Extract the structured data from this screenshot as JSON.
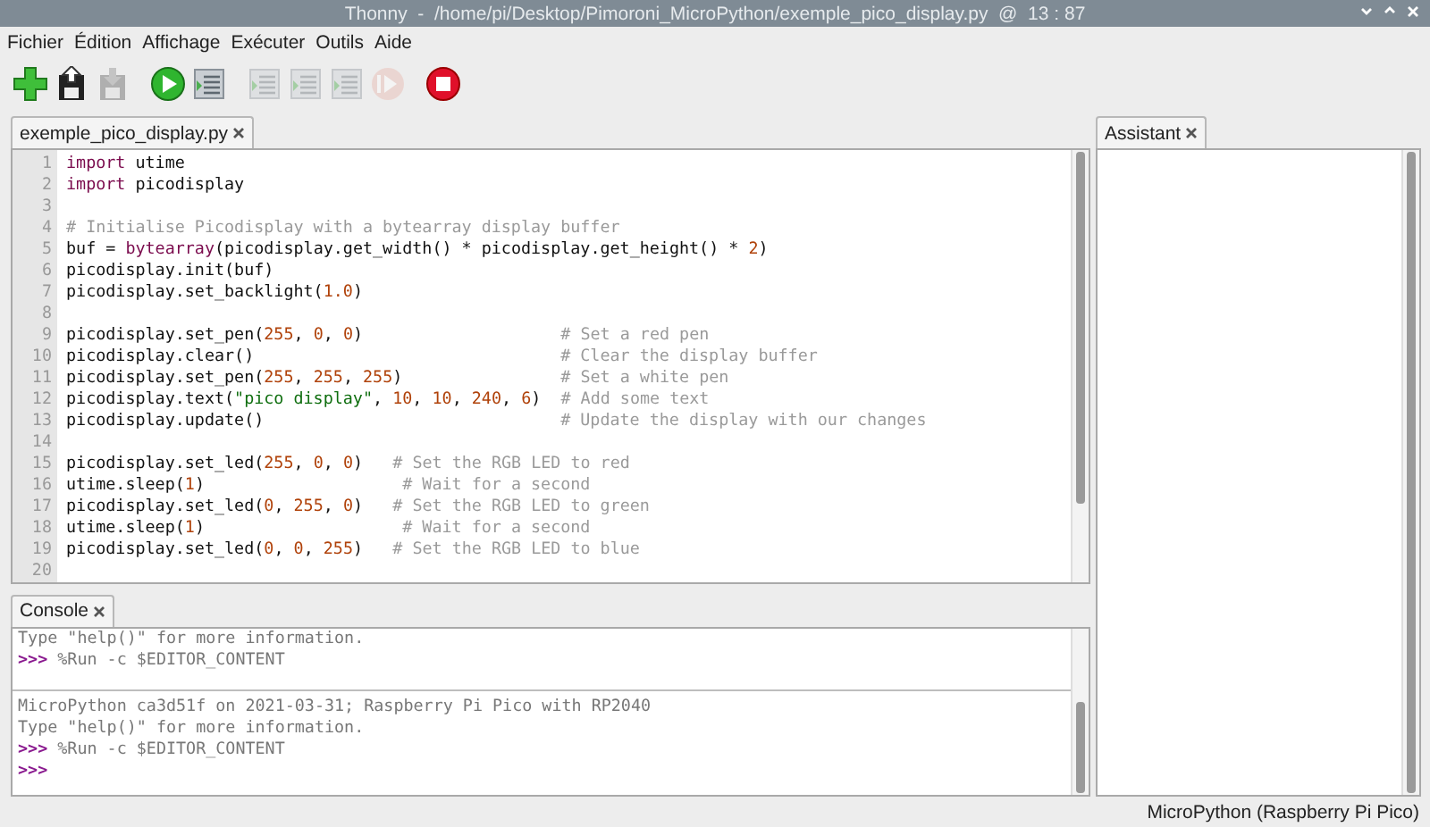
{
  "window": {
    "title": "Thonny  -  /home/pi/Desktop/Pimoroni_MicroPython/exemple_pico_display.py  @  13 : 87"
  },
  "menu": [
    "Fichier",
    "Édition",
    "Affichage",
    "Exécuter",
    "Outils",
    "Aide"
  ],
  "toolbar": [
    {
      "kind": "new",
      "disabled": false
    },
    {
      "kind": "load",
      "disabled": false
    },
    {
      "kind": "save",
      "disabled": true
    },
    {
      "kind": "run",
      "disabled": false
    },
    {
      "kind": "debug",
      "disabled": false
    },
    {
      "kind": "step_over",
      "disabled": true
    },
    {
      "kind": "step_into",
      "disabled": true
    },
    {
      "kind": "step_out",
      "disabled": true
    },
    {
      "kind": "resume",
      "disabled": true
    },
    {
      "kind": "stop",
      "disabled": false
    }
  ],
  "editor": {
    "tab": "exemple_pico_display.py",
    "lines": [
      {
        "number": "1",
        "segments": [
          {
            "kind": "keyword",
            "text": "import"
          },
          {
            "kind": "plain",
            "text": " utime"
          }
        ]
      },
      {
        "number": "2",
        "segments": [
          {
            "kind": "keyword",
            "text": "import"
          },
          {
            "kind": "plain",
            "text": " picodisplay"
          }
        ]
      },
      {
        "number": "3"
      },
      {
        "number": "4",
        "segments": [
          {
            "kind": "comment",
            "text": "# Initialise Picodisplay with a bytearray display buffer"
          }
        ]
      },
      {
        "number": "5",
        "segments": [
          {
            "kind": "plain",
            "text": "buf = "
          },
          {
            "kind": "keyword",
            "text": "bytearray"
          },
          {
            "kind": "plain",
            "text": "(picodisplay.get_width() * picodisplay.get_height() * "
          },
          {
            "kind": "number",
            "text": "2"
          },
          {
            "kind": "plain",
            "text": ")"
          }
        ]
      },
      {
        "number": "6",
        "segments": [
          {
            "kind": "plain",
            "text": "picodisplay.init(buf)"
          }
        ]
      },
      {
        "number": "7",
        "segments": [
          {
            "kind": "plain",
            "text": "picodisplay.set_backlight("
          },
          {
            "kind": "number",
            "text": "1.0"
          },
          {
            "kind": "plain",
            "text": ")"
          }
        ]
      },
      {
        "number": "8"
      },
      {
        "number": "9",
        "segments": [
          {
            "kind": "plain",
            "text": "picodisplay.set_pen("
          },
          {
            "kind": "number",
            "text": "255"
          },
          {
            "kind": "plain",
            "text": ", "
          },
          {
            "kind": "number",
            "text": "0"
          },
          {
            "kind": "plain",
            "text": ", "
          },
          {
            "kind": "number",
            "text": "0"
          },
          {
            "kind": "plain",
            "text": ")                    "
          },
          {
            "kind": "comment",
            "text": "# Set a red pen"
          }
        ]
      },
      {
        "number": "10",
        "segments": [
          {
            "kind": "plain",
            "text": "picodisplay.clear()                               "
          },
          {
            "kind": "comment",
            "text": "# Clear the display buffer"
          }
        ]
      },
      {
        "number": "11",
        "segments": [
          {
            "kind": "plain",
            "text": "picodisplay.set_pen("
          },
          {
            "kind": "number",
            "text": "255"
          },
          {
            "kind": "plain",
            "text": ", "
          },
          {
            "kind": "number",
            "text": "255"
          },
          {
            "kind": "plain",
            "text": ", "
          },
          {
            "kind": "number",
            "text": "255"
          },
          {
            "kind": "plain",
            "text": ")                "
          },
          {
            "kind": "comment",
            "text": "# Set a white pen"
          }
        ]
      },
      {
        "number": "12",
        "segments": [
          {
            "kind": "plain",
            "text": "picodisplay.text("
          },
          {
            "kind": "string",
            "text": "\"pico display\""
          },
          {
            "kind": "plain",
            "text": ", "
          },
          {
            "kind": "number",
            "text": "10"
          },
          {
            "kind": "plain",
            "text": ", "
          },
          {
            "kind": "number",
            "text": "10"
          },
          {
            "kind": "plain",
            "text": ", "
          },
          {
            "kind": "number",
            "text": "240"
          },
          {
            "kind": "plain",
            "text": ", "
          },
          {
            "kind": "number",
            "text": "6"
          },
          {
            "kind": "plain",
            "text": ")  "
          },
          {
            "kind": "comment",
            "text": "# Add some text"
          }
        ]
      },
      {
        "number": "13",
        "segments": [
          {
            "kind": "plain",
            "text": "picodisplay.update()                              "
          },
          {
            "kind": "comment",
            "text": "# Update the display with our changes"
          }
        ]
      },
      {
        "number": "14"
      },
      {
        "number": "15",
        "segments": [
          {
            "kind": "plain",
            "text": "picodisplay.set_led("
          },
          {
            "kind": "number",
            "text": "255"
          },
          {
            "kind": "plain",
            "text": ", "
          },
          {
            "kind": "number",
            "text": "0"
          },
          {
            "kind": "plain",
            "text": ", "
          },
          {
            "kind": "number",
            "text": "0"
          },
          {
            "kind": "plain",
            "text": ")   "
          },
          {
            "kind": "comment",
            "text": "# Set the RGB LED to red"
          }
        ]
      },
      {
        "number": "16",
        "segments": [
          {
            "kind": "plain",
            "text": "utime.sleep("
          },
          {
            "kind": "number",
            "text": "1"
          },
          {
            "kind": "plain",
            "text": ")                    "
          },
          {
            "kind": "comment",
            "text": "# Wait for a second"
          }
        ]
      },
      {
        "number": "17",
        "segments": [
          {
            "kind": "plain",
            "text": "picodisplay.set_led("
          },
          {
            "kind": "number",
            "text": "0"
          },
          {
            "kind": "plain",
            "text": ", "
          },
          {
            "kind": "number",
            "text": "255"
          },
          {
            "kind": "plain",
            "text": ", "
          },
          {
            "kind": "number",
            "text": "0"
          },
          {
            "kind": "plain",
            "text": ")   "
          },
          {
            "kind": "comment",
            "text": "# Set the RGB LED to green"
          }
        ]
      },
      {
        "number": "18",
        "segments": [
          {
            "kind": "plain",
            "text": "utime.sleep("
          },
          {
            "kind": "number",
            "text": "1"
          },
          {
            "kind": "plain",
            "text": ")                    "
          },
          {
            "kind": "comment",
            "text": "# Wait for a second"
          }
        ]
      },
      {
        "number": "19",
        "segments": [
          {
            "kind": "plain",
            "text": "picodisplay.set_led("
          },
          {
            "kind": "number",
            "text": "0"
          },
          {
            "kind": "plain",
            "text": ", "
          },
          {
            "kind": "number",
            "text": "0"
          },
          {
            "kind": "plain",
            "text": ", "
          },
          {
            "kind": "number",
            "text": "255"
          },
          {
            "kind": "plain",
            "text": ")   "
          },
          {
            "kind": "comment",
            "text": "# Set the RGB LED to blue"
          }
        ]
      },
      {
        "number": "20"
      }
    ]
  },
  "console": {
    "tab": "Console",
    "upper": [
      {
        "kind": "info",
        "text": "Type \"help()\" for more information."
      },
      {
        "kind": "prompt",
        "prompt": ">>>",
        "text": " %Run -c $EDITOR_CONTENT"
      }
    ],
    "lower": [
      {
        "kind": "info",
        "text": "MicroPython ca3d51f on 2021-03-31; Raspberry Pi Pico with RP2040"
      },
      {
        "kind": "info",
        "text": "Type \"help()\" for more information."
      },
      {
        "kind": "prompt",
        "prompt": ">>>",
        "text": " %Run -c $EDITOR_CONTENT"
      },
      {
        "kind": "prompt",
        "prompt": ">>>"
      }
    ]
  },
  "assistant": {
    "tab": "Assistant"
  },
  "status_bar": "MicroPython (Raspberry Pi Pico)"
}
